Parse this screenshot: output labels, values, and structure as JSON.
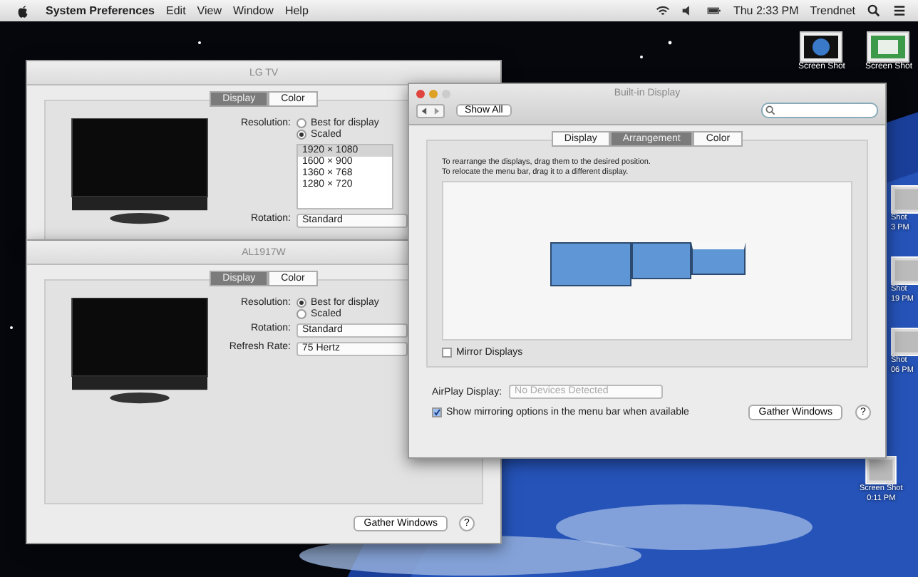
{
  "menu_bar": {
    "app_name": "System Preferences",
    "menus": [
      "Edit",
      "View",
      "Window",
      "Help"
    ],
    "clock": "Thu 2:33 PM",
    "user": "Trendnet"
  },
  "desktop_icons": [
    {
      "lines": [
        "Screen Shot"
      ]
    },
    {
      "lines": [
        "Screen Shot"
      ]
    }
  ],
  "edge_icons": [
    {
      "lines": [
        "Shot",
        "3 PM"
      ]
    },
    {
      "lines": [
        "Shot",
        "19 PM"
      ]
    },
    {
      "lines": [
        "Shot",
        "06 PM"
      ]
    },
    {
      "lines": [
        "Screen Shot",
        "0:11 PM"
      ]
    }
  ],
  "display_windows": [
    {
      "title": "LG TV",
      "tabs": [
        {
          "label": "Display",
          "selected": true
        },
        {
          "label": "Color",
          "selected": false
        }
      ],
      "resolution_label": "Resolution:",
      "resolution_options": [
        {
          "label": "Best for display",
          "selected": false
        },
        {
          "label": "Scaled",
          "selected": true
        }
      ],
      "scaled_resolutions": [
        {
          "label": "1920 × 1080",
          "selected": true
        },
        {
          "label": "1600 × 900",
          "selected": false
        },
        {
          "label": "1360 × 768",
          "selected": false
        },
        {
          "label": "1280 × 720",
          "selected": false
        }
      ],
      "popups": [
        {
          "label": "Rotation:",
          "value": "Standard"
        }
      ]
    },
    {
      "title": "AL1917W",
      "tabs": [
        {
          "label": "Display",
          "selected": true
        },
        {
          "label": "Color",
          "selected": false
        }
      ],
      "resolution_label": "Resolution:",
      "resolution_options": [
        {
          "label": "Best for display",
          "selected": true
        },
        {
          "label": "Scaled",
          "selected": false
        }
      ],
      "popups": [
        {
          "label": "Rotation:",
          "value": "Standard"
        },
        {
          "label": "Refresh Rate:",
          "value": "75 Hertz"
        }
      ],
      "gather_button": "Gather Windows",
      "help_button": "?"
    }
  ],
  "builtin_window": {
    "title": "Built-in Display",
    "show_all": "Show All",
    "tabs": [
      {
        "label": "Display",
        "selected": false
      },
      {
        "label": "Arrangement",
        "selected": true
      },
      {
        "label": "Color",
        "selected": false
      }
    ],
    "instructions": [
      "To rearrange the displays, drag them to the desired position.",
      "To relocate the menu bar, drag it to a different display."
    ],
    "mirror": {
      "label": "Mirror Displays",
      "checked": false
    },
    "airplay": {
      "label": "AirPlay Display:",
      "value": "No Devices Detected",
      "disabled": true
    },
    "show_mirroring": {
      "label": "Show mirroring options in the menu bar when available",
      "checked": true
    },
    "gather_button": "Gather Windows",
    "help_button": "?"
  }
}
